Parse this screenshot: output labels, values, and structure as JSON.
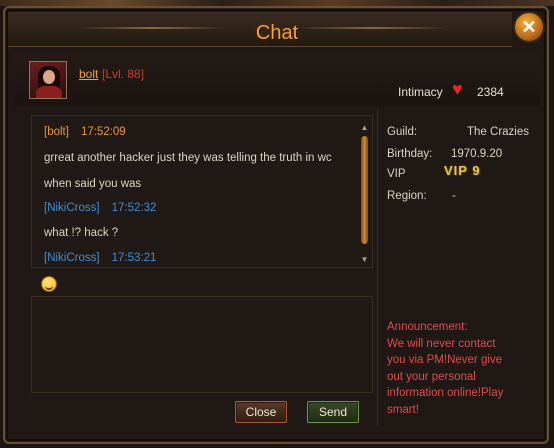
{
  "window": {
    "title": "Chat",
    "close_glyph": "✕"
  },
  "player": {
    "name": "bolt",
    "level": "[Lvl. 88]"
  },
  "intimacy": {
    "label": "Intimacy",
    "value": "2384",
    "icon": "heart-icon"
  },
  "messages": [
    {
      "sender": "[bolt]",
      "time": "17:52:09",
      "lines": [
        "grreat another hacker just they was telling the truth in wc",
        "when said you was"
      ],
      "color": "#e89a2e"
    },
    {
      "sender": "[NikiCross]",
      "time": "17:52:32",
      "lines": [
        "what !? hack ?"
      ],
      "color": "#3f8fd8"
    },
    {
      "sender": "[NikiCross]",
      "time": "17:53:21",
      "lines": [],
      "color": "#3f8fd8"
    }
  ],
  "profile": {
    "guild_label": "Guild:",
    "guild_value": "The Crazies",
    "birthday_label": "Birthday:",
    "birthday_value": "1970.9.20",
    "vip_label": "VIP",
    "vip_value": "VIP 9",
    "region_label": "Region:",
    "region_value": "-"
  },
  "announcement": {
    "lines": [
      "Announcement:",
      "We will never contact",
      "you via PM!Never give",
      "out your personal",
      "information online!Play",
      "smart!"
    ]
  },
  "input": {
    "value": ""
  },
  "buttons": {
    "close": "Close",
    "send": "Send"
  },
  "colors": {
    "accent": "#f2a33a",
    "announcement": "#e24b4b",
    "link_blue": "#3f8fd8"
  }
}
